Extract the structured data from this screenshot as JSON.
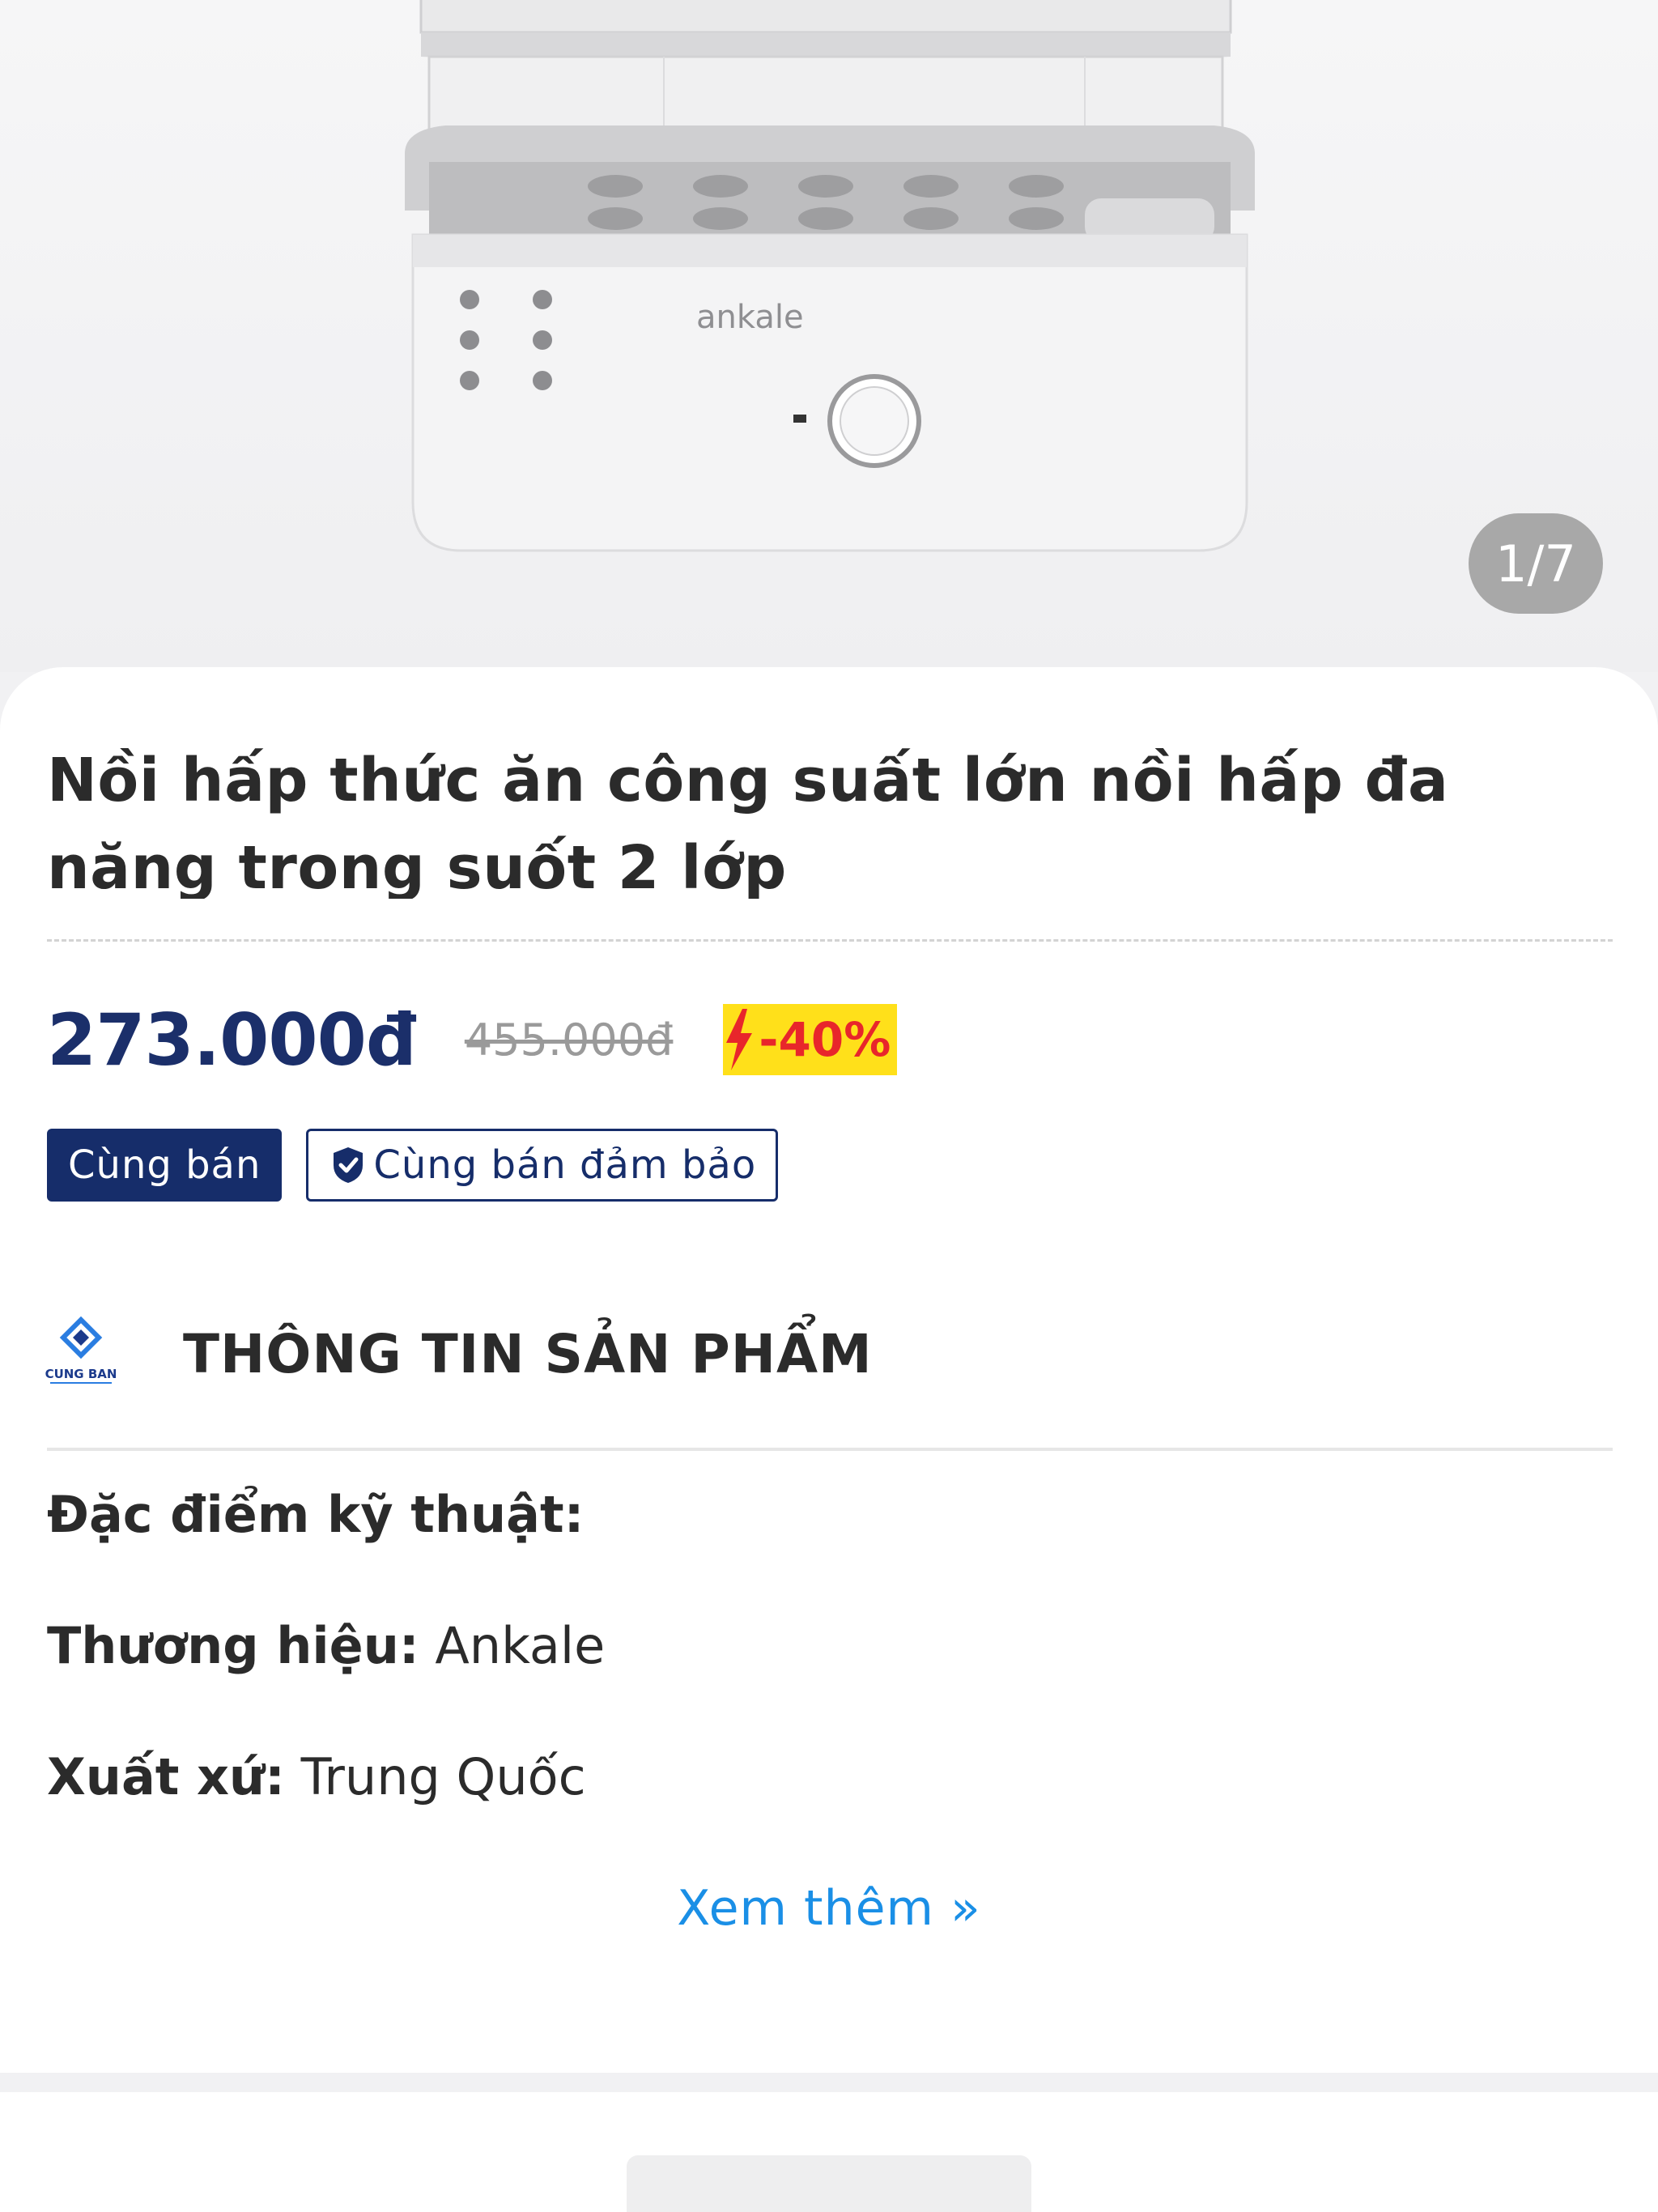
{
  "gallery": {
    "counter": "1/7",
    "brand_mark": "ankale"
  },
  "product": {
    "title": "Nồi hấp thức ăn công suất lớn nồi hấp đa năng trong suốt 2 lớp",
    "price": "273.000đ",
    "old_price": "455.000đ",
    "discount": "-40%",
    "badge_primary": "Cùng bán",
    "badge_guarantee": "Cùng bán đảm bảo"
  },
  "info": {
    "logo_text": "CUNG BAN",
    "section_title": "THÔNG TIN SẢN PHẨM",
    "specs_heading": "Đặc điểm kỹ thuật:",
    "brand_label": "Thương hiệu:",
    "brand_value": " Ankale",
    "origin_label": "Xuất xứ:",
    "origin_value": " Trung Quốc",
    "see_more": "Xem thêm »"
  },
  "colors": {
    "navy": "#162d6a",
    "link": "#1a8fe6",
    "sale_yellow": "#ffe01a",
    "sale_red": "#e8262b"
  }
}
